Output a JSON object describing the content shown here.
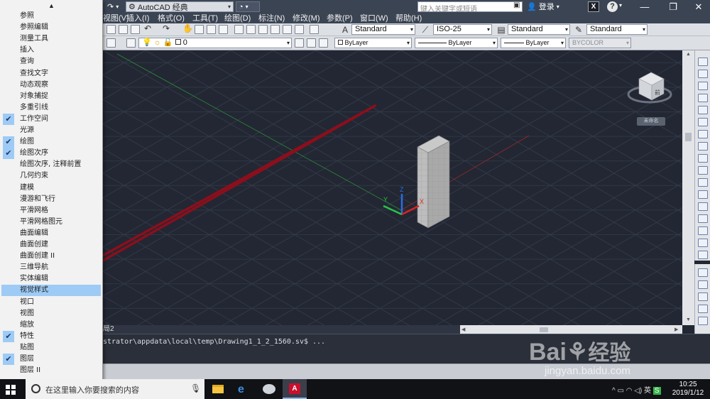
{
  "titlebar": {
    "workspace": "AutoCAD 经典",
    "search_placeholder": "键入关键字或短语",
    "login": "登录",
    "x_logo": "X",
    "help": "?",
    "min": "—",
    "max": "❐",
    "close": "✕"
  },
  "menubar": {
    "items": [
      "视图(V)",
      "插入(I)",
      "格式(O)",
      "工具(T)",
      "绘图(D)",
      "标注(N)",
      "修改(M)",
      "参数(P)",
      "窗口(W)",
      "帮助(H)"
    ]
  },
  "toolbar1": {
    "text_style": "Standard",
    "dim_style": "ISO-25",
    "table_style": "Standard",
    "mleader_style": "Standard"
  },
  "toolbar2": {
    "layer": "0",
    "color": "ByLayer",
    "linetype": "ByLayer",
    "lineweight": "ByLayer",
    "plotstyle": "BYCOLOR"
  },
  "canvas": {
    "ucs_y": "Y",
    "ucs_z": "Z",
    "ucs_x": "X",
    "viewcube_face": "前",
    "viewcube_wcs": "未命名"
  },
  "tabs": {
    "layout2": "局2"
  },
  "command": {
    "history": "strator\\appdata\\local\\temp\\Drawing1_1_2_1560.sv$ ..."
  },
  "context_menu": {
    "items": [
      {
        "label": "参照",
        "checked": false
      },
      {
        "label": "参照编辑",
        "checked": false
      },
      {
        "label": "测量工具",
        "checked": false
      },
      {
        "label": "插入",
        "checked": false
      },
      {
        "label": "查询",
        "checked": false
      },
      {
        "label": "查找文字",
        "checked": false
      },
      {
        "label": "动态观察",
        "checked": false
      },
      {
        "label": "对象捕捉",
        "checked": false
      },
      {
        "label": "多重引线",
        "checked": false
      },
      {
        "label": "工作空间",
        "checked": true
      },
      {
        "label": "光源",
        "checked": false
      },
      {
        "label": "绘图",
        "checked": true
      },
      {
        "label": "绘图次序",
        "checked": true
      },
      {
        "label": "绘图次序, 注释前置",
        "checked": false
      },
      {
        "label": "几何约束",
        "checked": false
      },
      {
        "label": "建模",
        "checked": false
      },
      {
        "label": "漫游和飞行",
        "checked": false
      },
      {
        "label": "平滑网格",
        "checked": false
      },
      {
        "label": "平滑网格图元",
        "checked": false
      },
      {
        "label": "曲面编辑",
        "checked": false
      },
      {
        "label": "曲面创建",
        "checked": false
      },
      {
        "label": "曲面创建 II",
        "checked": false
      },
      {
        "label": "三维导航",
        "checked": false
      },
      {
        "label": "实体编辑",
        "checked": false
      },
      {
        "label": "视觉样式",
        "checked": false,
        "highlighted": true
      },
      {
        "label": "视口",
        "checked": false
      },
      {
        "label": "视图",
        "checked": false
      },
      {
        "label": "缩放",
        "checked": false
      },
      {
        "label": "特性",
        "checked": true
      },
      {
        "label": "贴图",
        "checked": false
      },
      {
        "label": "图层",
        "checked": true
      },
      {
        "label": "图层 II",
        "checked": false
      }
    ]
  },
  "taskbar": {
    "search_placeholder": "在这里输入你要搜索的内容",
    "time": "10:25",
    "date": "2019/1/12"
  },
  "watermark": {
    "text": "jingyan.baidu.com"
  },
  "colors": {
    "canvas_bg": "#222733",
    "menu_highlight": "#9ecbf5",
    "annotation_arrow": "#8b0f1c"
  }
}
